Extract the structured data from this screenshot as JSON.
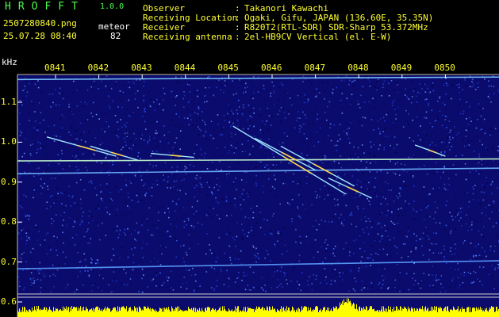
{
  "header": {
    "brand": "HROFFT",
    "version": "1.0.0",
    "filename": "2507280840.png",
    "datetime": "25.07.28 08:40",
    "meteor_label": "meteor",
    "meteor_count": "82"
  },
  "info": [
    {
      "label": "Observer",
      "value": "Takanori Kawachi"
    },
    {
      "label": "Receiving Location",
      "value": "Ogaki, Gifu, JAPAN (136.60E, 35.35N)"
    },
    {
      "label": "Receiver",
      "value": "R820T2(RTL-SDR) SDR-Sharp 53.372MHz"
    },
    {
      "label": "Receiving antenna",
      "value": "2el-HB9CV Vertical (el. E-W)"
    }
  ],
  "chart_data": {
    "type": "heatmap",
    "ylabel": "kHz",
    "x_ticks": [
      "0841",
      "0842",
      "0843",
      "0844",
      "0845",
      "0846",
      "0847",
      "0848",
      "0849",
      "0850"
    ],
    "y_ticks": [
      "1.1",
      "1.0",
      "0.9",
      "0.8",
      "0.7",
      "0.6"
    ],
    "x_range_minutes": [
      0,
      10
    ],
    "y_range_khz": [
      0.59,
      1.19
    ],
    "background_color": "#0b0b6e",
    "noise_colors": [
      "#1f3fd8",
      "#3a6bff",
      "#6f9cff",
      "#000038"
    ],
    "carriers_khz": [
      {
        "y0": 1.157,
        "y1": 1.163,
        "color": "#7fd0ff"
      },
      {
        "y0": 0.953,
        "y1": 0.958,
        "color": "#c8ffd0"
      },
      {
        "y0": 0.921,
        "y1": 0.935,
        "color": "#6fb8ff"
      },
      {
        "y0": 0.683,
        "y1": 0.703,
        "color": "#5aa0ff"
      }
    ],
    "meteor_traces": [
      {
        "t0": 0.8,
        "t1": 2.4,
        "f0": 1.013,
        "f1": 0.965
      },
      {
        "t0": 1.8,
        "t1": 2.9,
        "f0": 0.99,
        "f1": 0.955
      },
      {
        "t0": 3.2,
        "t1": 4.2,
        "f0": 0.972,
        "f1": 0.962
      },
      {
        "t0": 5.1,
        "t1": 7.7,
        "f0": 1.04,
        "f1": 0.87
      },
      {
        "t0": 5.6,
        "t1": 7.0,
        "f0": 1.01,
        "f1": 0.93
      },
      {
        "t0": 6.2,
        "t1": 7.9,
        "f0": 0.99,
        "f1": 0.89
      },
      {
        "t0": 7.3,
        "t1": 8.3,
        "f0": 0.91,
        "f1": 0.86
      },
      {
        "t0": 9.3,
        "t1": 10.0,
        "f0": 0.993,
        "f1": 0.965
      }
    ],
    "amplitude_strip_color": "#ffff00"
  }
}
